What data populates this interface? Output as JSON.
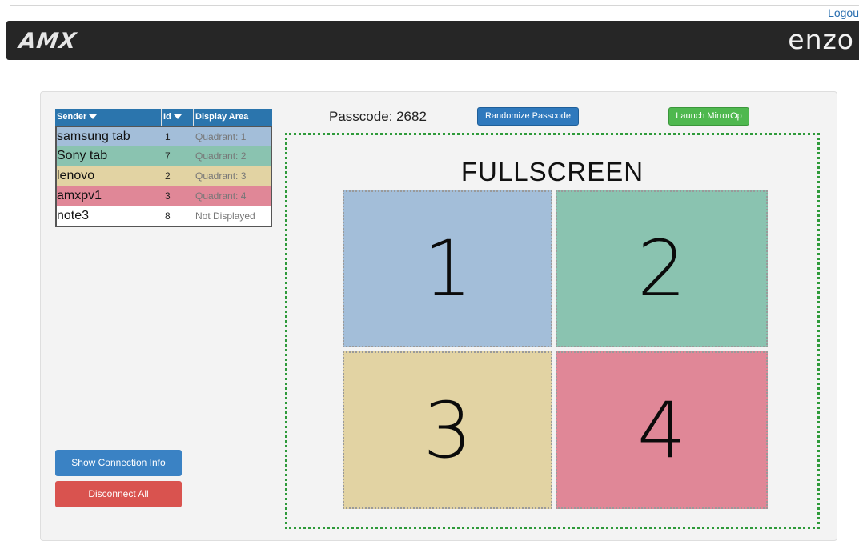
{
  "header": {
    "logout_label": "Logou",
    "logo_left": "AMX",
    "logo_right": "enzo"
  },
  "sender_table": {
    "columns": [
      "Sender",
      "Id",
      "Display Area"
    ],
    "rows": [
      {
        "sender": "samsung tab",
        "id": "1",
        "display_area": "Quadrant: 1",
        "color": "#a3bed9"
      },
      {
        "sender": "Sony tab",
        "id": "7",
        "display_area": "Quadrant: 2",
        "color": "#8ac3b0"
      },
      {
        "sender": "lenovo",
        "id": "2",
        "display_area": "Quadrant: 3",
        "color": "#e2d3a3"
      },
      {
        "sender": "amxpv1",
        "id": "3",
        "display_area": "Quadrant: 4",
        "color": "#e08797"
      },
      {
        "sender": "note3",
        "id": "8",
        "display_area": "Not Displayed",
        "color": "#ffffff"
      }
    ]
  },
  "buttons": {
    "show_connection_info": "Show Connection Info",
    "disconnect_all": "Disconnect All",
    "randomize_passcode": "Randomize Passcode",
    "launch_mirrorop": "Launch MirrorOp"
  },
  "passcode": {
    "label": "Passcode: 2682"
  },
  "display": {
    "title": "FULLSCREEN",
    "quadrants": [
      {
        "label": "1",
        "color": "#a3bed9"
      },
      {
        "label": "2",
        "color": "#8ac3b0"
      },
      {
        "label": "3",
        "color": "#e2d3a3"
      },
      {
        "label": "4",
        "color": "#e08797"
      }
    ]
  },
  "colors": {
    "header_bg": "#262626",
    "table_header_bg": "#2b75ad",
    "primary_button": "#3a82c4",
    "danger_button": "#d9534f",
    "success_button": "#4fb84f",
    "display_border": "#2e9a3a"
  }
}
